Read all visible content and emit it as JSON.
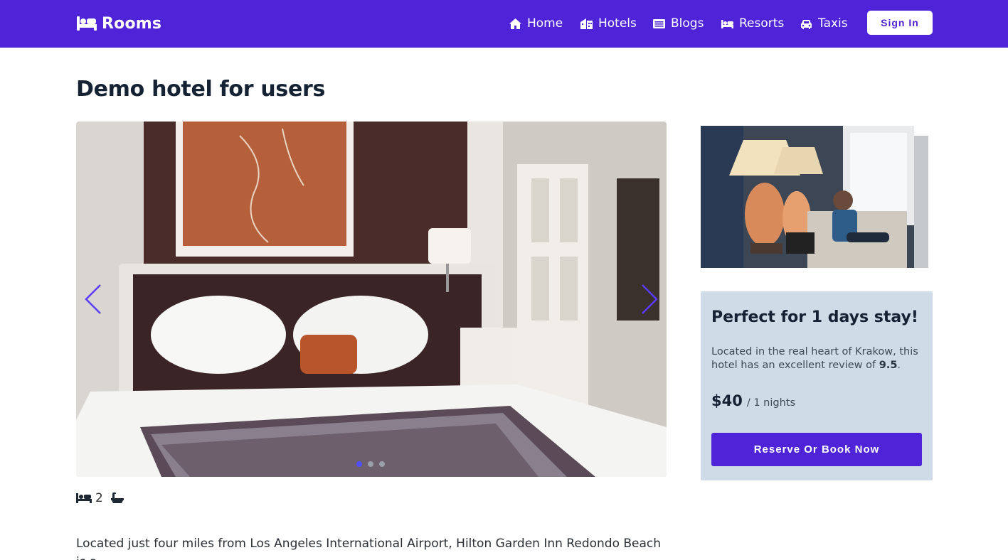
{
  "navbar": {
    "brand": "Rooms",
    "links": [
      {
        "label": "Home",
        "icon": "home-icon"
      },
      {
        "label": "Hotels",
        "icon": "hotel-icon"
      },
      {
        "label": "Blogs",
        "icon": "newspaper-icon"
      },
      {
        "label": "Resorts",
        "icon": "bed-icon"
      },
      {
        "label": "Taxis",
        "icon": "car-icon"
      }
    ],
    "sign_in": "Sign In"
  },
  "page": {
    "title": "Demo hotel for users"
  },
  "carousel": {
    "slides": 3,
    "active_index": 0
  },
  "amenities": {
    "bed_count": "2"
  },
  "description": "Located just four miles from Los Angeles International Airport, Hilton Garden Inn Redondo Beach is a",
  "booking": {
    "title": "Perfect for 1 days stay!",
    "desc_prefix": "Located in the real heart of Krakow, this hotel has an excellent review of ",
    "rating": "9.5",
    "desc_suffix": ".",
    "price": "$40",
    "price_unit": "/ 1 nights",
    "reserve": "Reserve Or Book Now"
  },
  "colors": {
    "brand": "#4f23d8",
    "card_bg": "#cfdbe7",
    "dot_active": "#4f4fff"
  }
}
